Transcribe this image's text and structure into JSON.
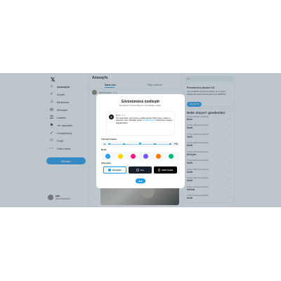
{
  "nav": {
    "logo": "𝕏",
    "items": [
      {
        "label": "Anasayfa",
        "icon": "home-icon",
        "glyph": "⌂"
      },
      {
        "label": "Keşfet",
        "icon": "search-icon",
        "glyph": "⌕"
      },
      {
        "label": "Bildirimler",
        "icon": "bell-icon",
        "glyph": "♫"
      },
      {
        "label": "Mesajlar",
        "icon": "mail-icon",
        "glyph": "✉"
      },
      {
        "label": "Listeler",
        "icon": "list-icon",
        "glyph": "☰"
      },
      {
        "label": "Yer İşaretleri",
        "icon": "bookmark-icon",
        "glyph": "⚑"
      },
      {
        "label": "Onaylanmış",
        "icon": "verified-icon",
        "glyph": "✓"
      },
      {
        "label": "Profil",
        "icon": "user-icon",
        "glyph": "☺"
      },
      {
        "label": "Daha fazla",
        "icon": "more-icon",
        "glyph": "⋯"
      }
    ],
    "post_label": "Gönder",
    "account": {
      "name": "ada",
      "handle": "@AdaKarake",
      "dots": "···"
    }
  },
  "center": {
    "title": "Anasayfa",
    "tab_for_you": "Sana özel",
    "tab_following": "Takip edilenler",
    "compose_handle": "@lovehana · 1 s"
  },
  "right": {
    "search_placeholder": "Ara",
    "premium_title": "Premium'a Abone Ol",
    "premium_text": "Yeni özellikleri açmak için abone ol ve uygun olduğunda içerik üreticisi gelir payı alabilirsin.",
    "premium_button": "Abone Ol",
    "trends_title": "Neler oluyor? gündemleri",
    "trends": [
      {
        "meta": "Türkiye tarihinde gündemde",
        "name": "Emre"
      },
      {
        "meta": "Türkiye tarihinde gündemde",
        "name": "Sorth"
      },
      {
        "meta": "Türkiye tarihinde gündemde",
        "name": "Tarih"
      },
      {
        "meta": "Türkiye tarihinde gündemde",
        "name": "Sorth"
      },
      {
        "meta": "Türkiye tarihinde gündemde",
        "name": "Deneyim"
      },
      {
        "meta": "Türkiye tarihinde gündemde",
        "name": "Sorth"
      },
      {
        "meta": "Türkiye tarihinde gündemde",
        "name": "Sorth"
      },
      {
        "meta": "Türkiye tarihinde gündemde",
        "name": "Sorth"
      },
      {
        "meta": "Türkiye tarihinde gündemde",
        "name": "Gürbük"
      },
      {
        "meta": "Türkiye tarihinde gündemde",
        "name": "Sorth"
      }
    ],
    "more_glyph": "···"
  },
  "modal": {
    "title": "Görünümünü özelleştir",
    "subtitle": "Bu ayarlar, bu tarayıcıdaki tüm X hesaplarını etkiler.",
    "preview": {
      "name": "X",
      "handle": "@X · 1 d",
      "body_start": "X'in merkezinde, işte bunlar şu şekilde görünür: Metin boyu, renkler ve arka plan. İpucu: Dilediğin zaman ",
      "link": "#TwitterHakkında",
      "body_end": " bölümünden ayarları değiştirebilirsin."
    },
    "font_label": "Yazı tipi boyutu",
    "font_small": "Aa",
    "font_large": "Aa",
    "font_size_level": 0.5,
    "color_label": "Renk",
    "colors": [
      "#1d9bf0",
      "#ffd400",
      "#f91880",
      "#7856ff",
      "#ff7a00",
      "#00ba7c"
    ],
    "selected_color_index": 0,
    "check_glyph": "✓",
    "background_label": "Arka plan",
    "backgrounds": [
      "Varsayılan",
      "Loş",
      "Işıklar Kapalı"
    ],
    "selected_background_index": 0,
    "done_label": "Bitti"
  }
}
